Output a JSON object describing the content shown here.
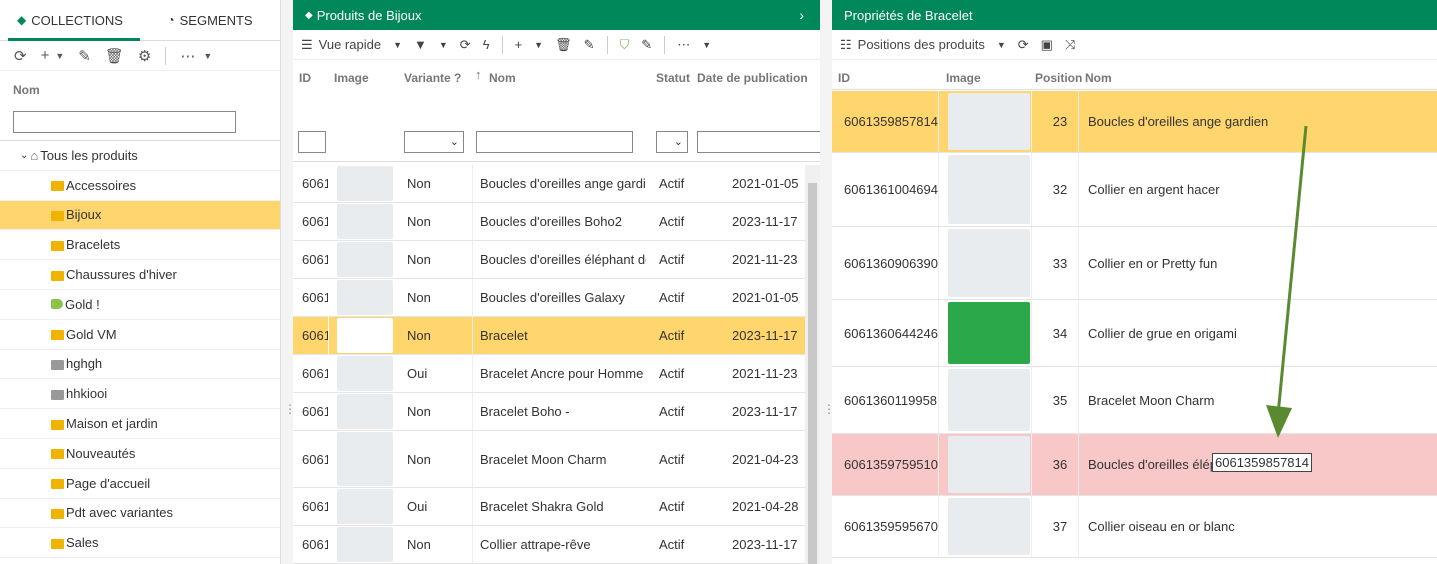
{
  "left": {
    "tabs": [
      {
        "label": "COLLECTIONS"
      },
      {
        "label": "SEGMENTS"
      }
    ],
    "column_header": "Nom",
    "root": "Tous les produits",
    "items": [
      {
        "label": "Accessoires",
        "icon": "folder-icon"
      },
      {
        "label": "Bijoux",
        "icon": "folder-icon",
        "selected": true
      },
      {
        "label": "Bracelets",
        "icon": "folder-icon"
      },
      {
        "label": "Chaussures d'hiver",
        "icon": "folder-icon"
      },
      {
        "label": "Gold !",
        "icon": "tag-icon"
      },
      {
        "label": "Gold VM",
        "icon": "folder-icon"
      },
      {
        "label": "hghgh",
        "icon": "folder-grey-icon"
      },
      {
        "label": "hhkiooi",
        "icon": "folder-grey-icon"
      },
      {
        "label": "Maison et jardin",
        "icon": "folder-icon"
      },
      {
        "label": "Nouveautés",
        "icon": "folder-icon"
      },
      {
        "label": "Page d'accueil",
        "icon": "folder-icon"
      },
      {
        "label": "Pdt avec variantes",
        "icon": "folder-icon"
      },
      {
        "label": "Sales",
        "icon": "folder-icon"
      }
    ]
  },
  "mid": {
    "title": "Produits de Bijoux",
    "view_label": "Vue rapide",
    "headers": {
      "id": "ID",
      "image": "Image",
      "variant": "Variante ?",
      "name": "Nom",
      "status": "Statut",
      "date": "Date de publication"
    },
    "rows": [
      {
        "id": "6061",
        "variant": "Non",
        "name": "Boucles d'oreilles ange gardien",
        "status": "Actif",
        "date": "2021-01-05"
      },
      {
        "id": "6061",
        "variant": "Non",
        "name": "Boucles d'oreilles Boho2",
        "status": "Actif",
        "date": "2023-11-17"
      },
      {
        "id": "6061",
        "variant": "Non",
        "name": "Boucles d'oreilles éléphant doré",
        "status": "Actif",
        "date": "2021-11-23"
      },
      {
        "id": "6061",
        "variant": "Non",
        "name": "Boucles d'oreilles Galaxy",
        "status": "Actif",
        "date": "2021-01-05"
      },
      {
        "id": "6061",
        "variant": "Non",
        "name": "Bracelet",
        "status": "Actif",
        "date": "2023-11-17",
        "selected": true
      },
      {
        "id": "6061",
        "variant": "Oui",
        "name": "Bracelet Ancre pour Homme m",
        "status": "Actif",
        "date": "2021-11-23"
      },
      {
        "id": "6061",
        "variant": "Non",
        "name": "Bracelet Boho -",
        "status": "Actif",
        "date": "2023-11-17"
      },
      {
        "id": "6061",
        "variant": "Non",
        "name": "Bracelet Moon Charm",
        "status": "Actif",
        "date": "2021-04-23"
      },
      {
        "id": "6061",
        "variant": "Oui",
        "name": "Bracelet Shakra Gold",
        "status": "Actif",
        "date": "2021-04-28"
      },
      {
        "id": "6061",
        "variant": "Non",
        "name": "Collier attrape-rêve",
        "status": "Actif",
        "date": "2023-11-17"
      }
    ]
  },
  "right": {
    "title": "Propriétés de Bracelet",
    "positions_label": "Positions des produits",
    "headers": {
      "id": "ID",
      "image": "Image",
      "position": "Position",
      "name": "Nom"
    },
    "rows": [
      {
        "id": "6061359857814",
        "position": "23",
        "name": "Boucles d'oreilles ange gardien",
        "highlight": "yellow"
      },
      {
        "id": "6061361004694",
        "position": "32",
        "name": "Collier en argent hacer"
      },
      {
        "id": "6061360906390",
        "position": "33",
        "name": "Collier en or Pretty fun"
      },
      {
        "id": "6061360644246",
        "position": "34",
        "name": "Collier de grue en origami"
      },
      {
        "id": "6061360119958",
        "position": "35",
        "name": "Bracelet Moon Charm"
      },
      {
        "id": "6061359759510",
        "position": "36",
        "name": "Boucles d'oreilles élép",
        "highlight": "pink"
      },
      {
        "id": "6061359595670",
        "position": "37",
        "name": "Collier oiseau en or blanc"
      }
    ],
    "drag_label": "6061359857814",
    "colors": {
      "accent": "#00875a",
      "selected": "#ffd66e",
      "drop_target": "#f8c8c8",
      "arrow": "#5a8a2f"
    }
  }
}
